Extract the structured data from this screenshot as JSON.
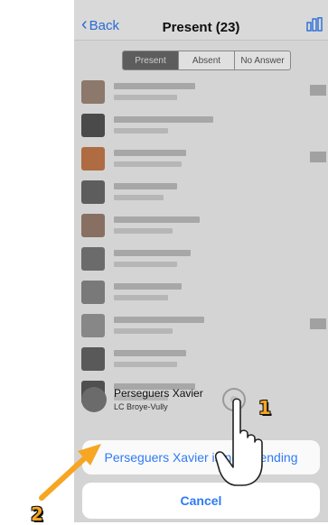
{
  "navbar": {
    "back_label": "Back",
    "title": "Present (23)"
  },
  "segments": [
    "Present",
    "Absent",
    "No Answer"
  ],
  "person": {
    "name": "Perseguers Xavier",
    "club": "LC Broye-Vully"
  },
  "action_sheet": {
    "action_label": "Perseguers Xavier is not attending",
    "cancel_label": "Cancel"
  },
  "annotations": {
    "step1": "1",
    "step2": "2"
  },
  "colors": {
    "accent": "#2f7bf5",
    "annotation": "#f6a623"
  }
}
